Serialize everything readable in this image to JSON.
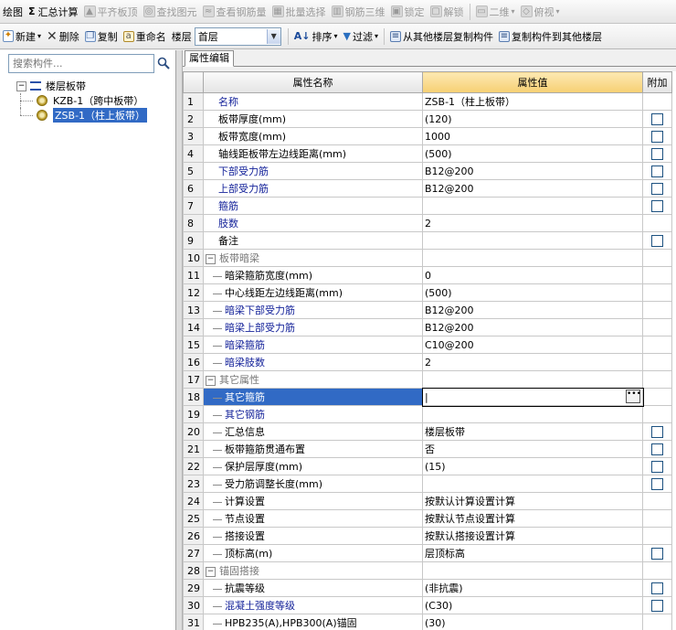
{
  "toolbar1": [
    {
      "label": "绘图",
      "icon": "",
      "disabled": false
    },
    {
      "label": "汇总计算",
      "icon": "Σ",
      "disabled": false
    },
    {
      "label": "平齐板顶",
      "icon": "▲",
      "disabled": true
    },
    {
      "label": "查找图元",
      "icon": "◎",
      "disabled": true
    },
    {
      "label": "查看钢筋量",
      "icon": "≈",
      "disabled": true
    },
    {
      "label": "批量选择",
      "icon": "▦",
      "disabled": true
    },
    {
      "label": "钢筋三维",
      "icon": "▥",
      "disabled": true
    },
    {
      "label": "锁定",
      "icon": "▣",
      "disabled": true
    },
    {
      "label": "解锁",
      "icon": "▢",
      "disabled": true
    },
    {
      "label": "二维",
      "icon": "▭",
      "disabled": true
    },
    {
      "label": "俯视",
      "icon": "◇",
      "disabled": true
    }
  ],
  "toolbar2": {
    "new_label": "新建",
    "delete_label": "删除",
    "copy_label": "复制",
    "rename_label": "重命名",
    "floor_label": "楼层",
    "floor_value": "首层",
    "sort_label": "排序",
    "filter_label": "过滤",
    "copy_from_label": "从其他楼层复制构件",
    "copy_to_label": "复制构件到其他楼层"
  },
  "search": {
    "placeholder": "搜索构件..."
  },
  "tree": {
    "root": "楼层板带",
    "children": [
      "KZB-1（跨中板带）",
      "ZSB-1（柱上板带）"
    ]
  },
  "tab_label": "属性编辑",
  "table": {
    "headers": [
      "属性名称",
      "属性值",
      "附加"
    ],
    "rows": [
      {
        "n": "1",
        "name": "名称",
        "value": "ZSB-1（柱上板带）",
        "blue": true,
        "indent": 0,
        "check": false
      },
      {
        "n": "2",
        "name": "板带厚度(mm)",
        "value": "(120)",
        "blue": false,
        "indent": 0,
        "check": true
      },
      {
        "n": "3",
        "name": "板带宽度(mm)",
        "value": "1000",
        "blue": false,
        "indent": 0,
        "check": true
      },
      {
        "n": "4",
        "name": "轴线距板带左边线距离(mm)",
        "value": "(500)",
        "blue": false,
        "indent": 0,
        "check": true
      },
      {
        "n": "5",
        "name": "下部受力筋",
        "value": "B12@200",
        "blue": true,
        "indent": 0,
        "check": true
      },
      {
        "n": "6",
        "name": "上部受力筋",
        "value": "B12@200",
        "blue": true,
        "indent": 0,
        "check": true
      },
      {
        "n": "7",
        "name": "箍筋",
        "value": "",
        "blue": true,
        "indent": 0,
        "check": true
      },
      {
        "n": "8",
        "name": "肢数",
        "value": "2",
        "blue": true,
        "indent": 0,
        "check": false
      },
      {
        "n": "9",
        "name": "备注",
        "value": "",
        "blue": false,
        "indent": 0,
        "check": true
      },
      {
        "n": "10",
        "name": "板带暗梁",
        "value": "",
        "blue": false,
        "group": true,
        "check": false
      },
      {
        "n": "11",
        "name": "暗梁箍筋宽度(mm)",
        "value": "0",
        "blue": false,
        "indent": 1,
        "check": false
      },
      {
        "n": "12",
        "name": "中心线距左边线距离(mm)",
        "value": "(500)",
        "blue": false,
        "indent": 1,
        "check": false
      },
      {
        "n": "13",
        "name": "暗梁下部受力筋",
        "value": "B12@200",
        "blue": true,
        "indent": 1,
        "check": false
      },
      {
        "n": "14",
        "name": "暗梁上部受力筋",
        "value": "B12@200",
        "blue": true,
        "indent": 1,
        "check": false
      },
      {
        "n": "15",
        "name": "暗梁箍筋",
        "value": "C10@200",
        "blue": true,
        "indent": 1,
        "check": false
      },
      {
        "n": "16",
        "name": "暗梁肢数",
        "value": "2",
        "blue": true,
        "indent": 1,
        "check": false
      },
      {
        "n": "17",
        "name": "其它属性",
        "value": "",
        "blue": false,
        "group": true,
        "check": false
      },
      {
        "n": "18",
        "name": "其它箍筋",
        "value": "",
        "blue": true,
        "indent": 1,
        "check": false,
        "selected": true
      },
      {
        "n": "19",
        "name": "其它钢筋",
        "value": "",
        "blue": true,
        "indent": 1,
        "check": false
      },
      {
        "n": "20",
        "name": "汇总信息",
        "value": "楼层板带",
        "blue": false,
        "indent": 1,
        "check": true
      },
      {
        "n": "21",
        "name": "板带箍筋贯通布置",
        "value": "否",
        "blue": false,
        "indent": 1,
        "check": true
      },
      {
        "n": "22",
        "name": "保护层厚度(mm)",
        "value": "(15)",
        "blue": false,
        "indent": 1,
        "check": true
      },
      {
        "n": "23",
        "name": "受力筋调整长度(mm)",
        "value": "",
        "blue": false,
        "indent": 1,
        "check": true
      },
      {
        "n": "24",
        "name": "计算设置",
        "value": "按默认计算设置计算",
        "blue": false,
        "indent": 1,
        "check": false
      },
      {
        "n": "25",
        "name": "节点设置",
        "value": "按默认节点设置计算",
        "blue": false,
        "indent": 1,
        "check": false
      },
      {
        "n": "26",
        "name": "搭接设置",
        "value": "按默认搭接设置计算",
        "blue": false,
        "indent": 1,
        "check": false
      },
      {
        "n": "27",
        "name": "顶标高(m)",
        "value": "层顶标高",
        "blue": false,
        "indent": 1,
        "check": true
      },
      {
        "n": "28",
        "name": "锚固搭接",
        "value": "",
        "blue": false,
        "group": true,
        "check": false
      },
      {
        "n": "29",
        "name": "抗震等级",
        "value": "(非抗震)",
        "blue": false,
        "indent": 1,
        "check": true
      },
      {
        "n": "30",
        "name": "混凝土强度等级",
        "value": "(C30)",
        "blue": true,
        "indent": 1,
        "check": true
      },
      {
        "n": "31",
        "name": "HPB235(A),HPB300(A)锚固",
        "value": "(30)",
        "blue": false,
        "indent": 1,
        "check": false
      }
    ]
  },
  "colors": {
    "selection": "#316ac5",
    "link_blue": "#15239a",
    "header_value": "#f6cf73"
  }
}
